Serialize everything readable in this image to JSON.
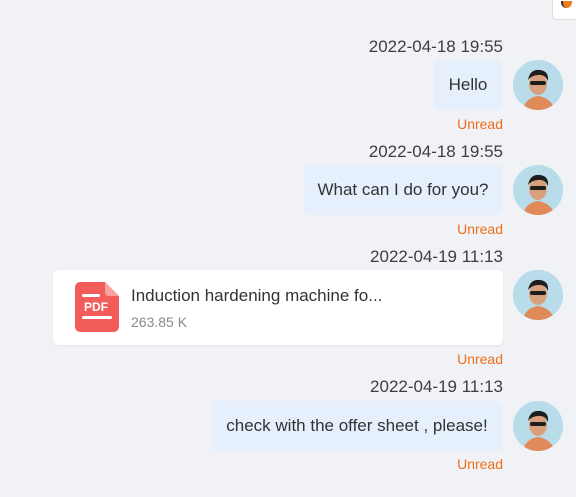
{
  "messages": [
    {
      "timestamp": "2022-04-18 19:55",
      "text": "Hello",
      "status": "Unread"
    },
    {
      "timestamp": "2022-04-18 19:55",
      "text": "What can I do for you?",
      "status": "Unread"
    },
    {
      "timestamp": "2022-04-19 11:13",
      "file": {
        "icon": "pdf-icon",
        "icon_label": "PDF",
        "name": "Induction hardening machine fo...",
        "size": "263.85 K"
      },
      "status": "Unread"
    },
    {
      "timestamp": "2022-04-19 11:13",
      "text": "check with the offer sheet , please!",
      "status": "Unread"
    }
  ],
  "colors": {
    "background": "#f1f2f5",
    "bubble": "#e5f0fc",
    "status": "#ee6e1c",
    "pdf_icon": "#f25c5a",
    "file_card": "#ffffff"
  }
}
